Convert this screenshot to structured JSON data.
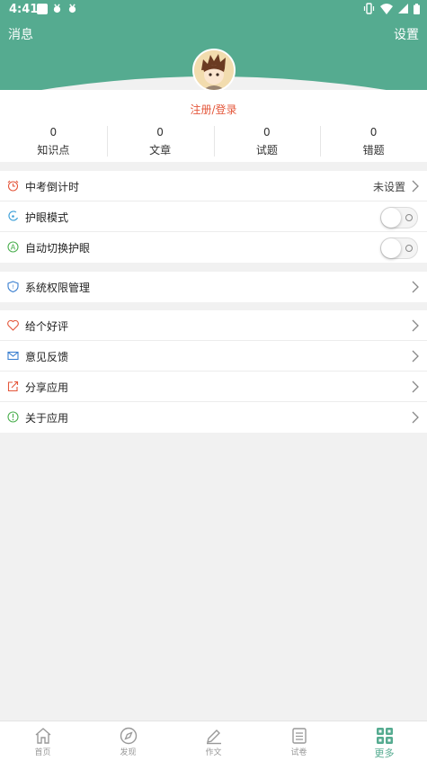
{
  "status_bar": {
    "time": "4:41"
  },
  "header": {
    "left_label": "消息",
    "right_label": "设置"
  },
  "profile": {
    "login_label": "注册/登录"
  },
  "stats": [
    {
      "value": "0",
      "label": "知识点"
    },
    {
      "value": "0",
      "label": "文章"
    },
    {
      "value": "0",
      "label": "试题"
    },
    {
      "value": "0",
      "label": "错题"
    }
  ],
  "settings": {
    "countdown": {
      "label": "中考倒计时",
      "value": "未设置"
    },
    "eye_mode": {
      "label": "护眼模式",
      "enabled": false
    },
    "auto_eye": {
      "label": "自动切换护眼",
      "enabled": false
    },
    "permissions": {
      "label": "系统权限管理"
    },
    "rate": {
      "label": "给个好评"
    },
    "feedback": {
      "label": "意见反馈"
    },
    "share": {
      "label": "分享应用"
    },
    "about": {
      "label": "关于应用"
    }
  },
  "bottom_nav": [
    {
      "label": "首页",
      "icon": "home-icon"
    },
    {
      "label": "发现",
      "icon": "compass-icon"
    },
    {
      "label": "作文",
      "icon": "pencil-icon"
    },
    {
      "label": "试卷",
      "icon": "document-icon"
    },
    {
      "label": "更多",
      "icon": "grid-icon",
      "active": true
    }
  ],
  "colors": {
    "brand": "#55ab90",
    "accent_red": "#e4573b",
    "background": "#f1f1f1"
  }
}
